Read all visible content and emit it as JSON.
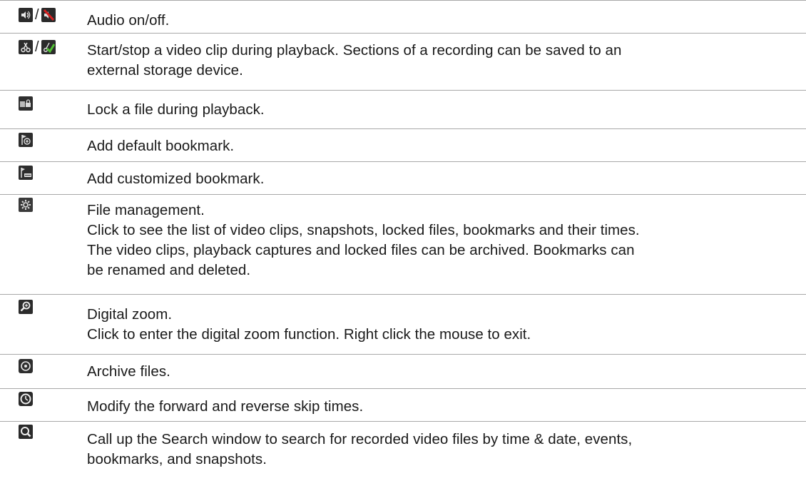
{
  "rows": [
    {
      "icons": [
        "speaker-icon",
        "speaker-muted-icon"
      ],
      "separator": "/",
      "lines": [
        "Audio on/off."
      ]
    },
    {
      "icons": [
        "scissors-icon",
        "scissors-check-icon"
      ],
      "separator": "/",
      "lines": [
        "Start/stop a video clip during playback. Sections of a recording can be saved to an",
        "external storage device."
      ]
    },
    {
      "icons": [
        "lock-file-icon"
      ],
      "lines": [
        "Lock a file during playback."
      ]
    },
    {
      "icons": [
        "bookmark-add-icon"
      ],
      "lines": [
        "Add default bookmark."
      ]
    },
    {
      "icons": [
        "bookmark-custom-icon"
      ],
      "lines": [
        "Add customized bookmark."
      ]
    },
    {
      "icons": [
        "gear-icon"
      ],
      "lines": [
        "File management.",
        "Click to see the list of video clips, snapshots, locked files, bookmarks and their times.",
        "The video clips, playback captures and locked files can be archived. Bookmarks can",
        "be renamed and deleted."
      ]
    },
    {
      "icons": [
        "zoom-icon"
      ],
      "lines": [
        "Digital zoom.",
        "Click to enter the digital zoom function. Right click the mouse to exit."
      ]
    },
    {
      "icons": [
        "archive-disc-icon"
      ],
      "lines": [
        "Archive files."
      ]
    },
    {
      "icons": [
        "clock-icon"
      ],
      "lines": [
        "Modify the forward and reverse skip times."
      ]
    },
    {
      "icons": [
        "search-icon"
      ],
      "lines": [
        "Call up the Search window to search for recorded video files by time & date, events,",
        "bookmarks, and snapshots."
      ]
    }
  ]
}
